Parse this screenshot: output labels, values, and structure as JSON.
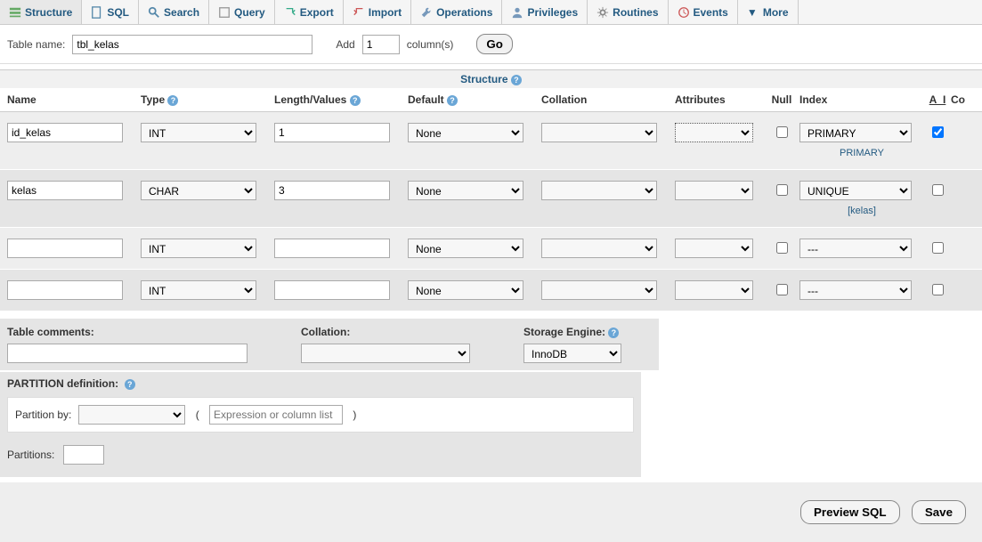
{
  "tabs": {
    "structure": "Structure",
    "sql": "SQL",
    "search": "Search",
    "query": "Query",
    "export": "Export",
    "import": "Import",
    "operations": "Operations",
    "privileges": "Privileges",
    "routines": "Routines",
    "events": "Events",
    "more": "More"
  },
  "toolbar": {
    "table_name_label": "Table name:",
    "table_name_value": "tbl_kelas",
    "add_label": "Add",
    "add_count": "1",
    "columns_label": "column(s)",
    "go_label": "Go"
  },
  "struct_heading": "Structure",
  "headers": {
    "name": "Name",
    "type": "Type",
    "length": "Length/Values",
    "default": "Default",
    "collation": "Collation",
    "attributes": "Attributes",
    "null": "Null",
    "index": "Index",
    "ai": "A_I",
    "comments": "Co"
  },
  "rows": [
    {
      "name": "id_kelas",
      "type": "INT",
      "length": "1",
      "default": "None",
      "index": "PRIMARY",
      "index_sub": "PRIMARY",
      "ai": true
    },
    {
      "name": "kelas",
      "type": "CHAR",
      "length": "3",
      "default": "None",
      "index": "UNIQUE",
      "index_sub": "[kelas]",
      "ai": false
    },
    {
      "name": "",
      "type": "INT",
      "length": "",
      "default": "None",
      "index": "---",
      "index_sub": "",
      "ai": false
    },
    {
      "name": "",
      "type": "INT",
      "length": "",
      "default": "None",
      "index": "---",
      "index_sub": "",
      "ai": false
    }
  ],
  "footer": {
    "table_comments_label": "Table comments:",
    "table_comments_value": "",
    "collation_label": "Collation:",
    "collation_value": "",
    "storage_engine_label": "Storage Engine:",
    "storage_engine_value": "InnoDB"
  },
  "partition": {
    "title": "PARTITION definition:",
    "partition_by_label": "Partition by:",
    "partition_by_value": "",
    "expr_placeholder": "Expression or column list",
    "partitions_label": "Partitions:",
    "partitions_value": ""
  },
  "actions": {
    "preview": "Preview SQL",
    "save": "Save"
  }
}
